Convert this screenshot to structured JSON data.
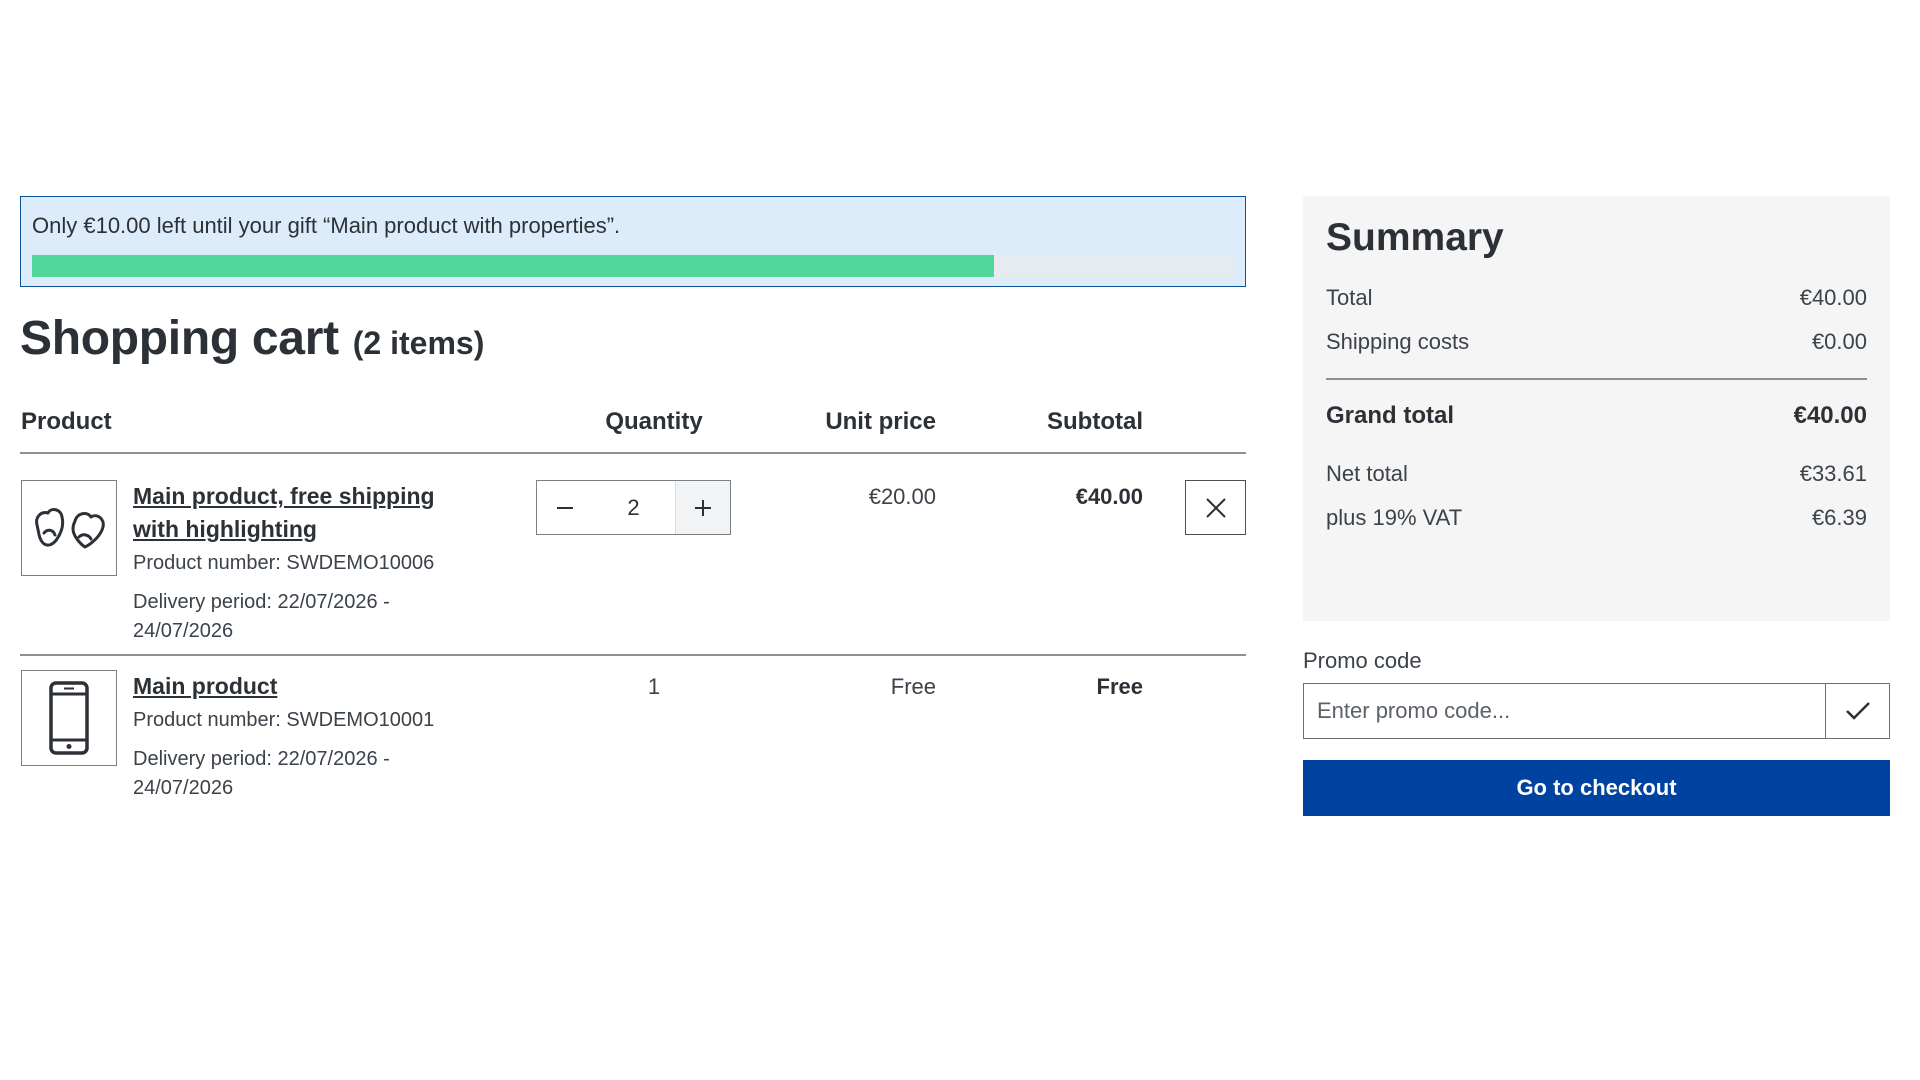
{
  "gift_banner": {
    "text": "Only €10.00 left until your gift “Main product with properties”.",
    "progress": 0.8,
    "bar_color": "#52d69c",
    "background": "#dcecfa"
  },
  "cart": {
    "title": "Shopping cart",
    "item_count": "(2 items)",
    "headers": {
      "product": "Product",
      "quantity": "Quantity",
      "unit_price": "Unit price",
      "subtotal": "Subtotal"
    },
    "items": [
      {
        "name": "Main product, free shipping with highlighting",
        "product_number": "Product number: SWDEMO10006",
        "delivery": "Delivery period: 22/07/2026 - 24/07/2026",
        "quantity": "2",
        "unit_price": "€20.00",
        "subtotal": "€40.00",
        "icon": "gloves-icon"
      },
      {
        "name": "Main product",
        "product_number": "Product number: SWDEMO10001",
        "delivery": "Delivery period: 22/07/2026 - 24/07/2026",
        "quantity": "1",
        "unit_price": "Free",
        "subtotal": "Free",
        "icon": "smartphone-icon"
      }
    ]
  },
  "summary": {
    "title": "Summary",
    "total_label": "Total",
    "total_value": "€40.00",
    "shipping_label": "Shipping costs",
    "shipping_value": "€0.00",
    "grand_total_label": "Grand total",
    "grand_total_value": "€40.00",
    "net_total_label": "Net total",
    "net_total_value": "€33.61",
    "vat_label": "plus 19% VAT",
    "vat_value": "€6.39"
  },
  "promo": {
    "label": "Promo code",
    "placeholder": "Enter promo code..."
  },
  "checkout": {
    "label": "Go to checkout",
    "color": "#0042a0"
  }
}
